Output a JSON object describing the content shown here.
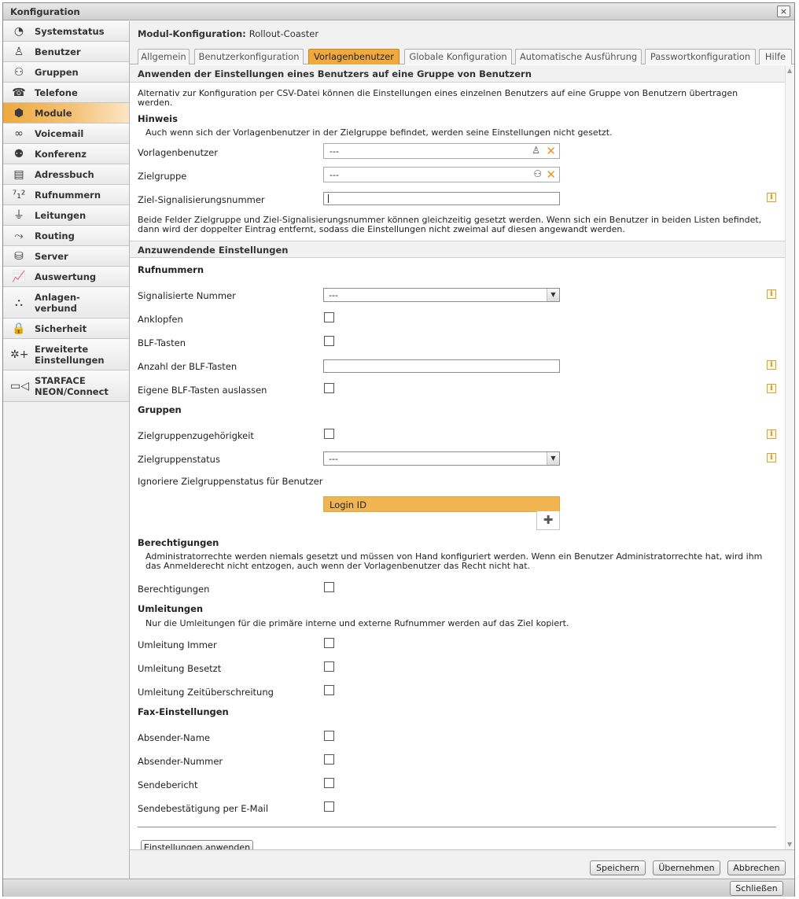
{
  "window": {
    "title": "Konfiguration",
    "close_glyph": "×"
  },
  "sidebar": {
    "items": [
      {
        "label": "Systemstatus",
        "icon": "gauge-icon",
        "glyph": "◔"
      },
      {
        "label": "Benutzer",
        "icon": "user-icon",
        "glyph": "♙"
      },
      {
        "label": "Gruppen",
        "icon": "group-icon",
        "glyph": "⚇"
      },
      {
        "label": "Telefone",
        "icon": "phone-icon",
        "glyph": "☎"
      },
      {
        "label": "Module",
        "icon": "module-icon",
        "glyph": "⬢"
      },
      {
        "label": "Voicemail",
        "icon": "voicemail-icon",
        "glyph": "∞"
      },
      {
        "label": "Konferenz",
        "icon": "conference-icon",
        "glyph": "⚉"
      },
      {
        "label": "Adressbuch",
        "icon": "addressbook-icon",
        "glyph": "▤"
      },
      {
        "label": "Rufnummern",
        "icon": "numbers-icon",
        "glyph": "⁷₁²"
      },
      {
        "label": "Leitungen",
        "icon": "lines-icon",
        "glyph": "⏚"
      },
      {
        "label": "Routing",
        "icon": "routing-icon",
        "glyph": "⤳"
      },
      {
        "label": "Server",
        "icon": "server-icon",
        "glyph": "⛁"
      },
      {
        "label": "Auswertung",
        "icon": "chart-icon",
        "glyph": "📈"
      },
      {
        "label": "Anlagen-\nverbund",
        "icon": "network-icon",
        "glyph": "⛬"
      },
      {
        "label": "Sicherheit",
        "icon": "lock-icon",
        "glyph": "🔒"
      },
      {
        "label": "Erweiterte\nEinstellungen",
        "icon": "advanced-settings-icon",
        "glyph": "✲+"
      },
      {
        "label": "STARFACE\nNEON/Connect",
        "icon": "video-icon",
        "glyph": "▭◁"
      }
    ],
    "active_index": 4
  },
  "module_header": {
    "label": "Modul-Konfiguration:",
    "name": "Rollout-Coaster"
  },
  "tabs": [
    {
      "label": "Allgemein"
    },
    {
      "label": "Benutzerkonfiguration"
    },
    {
      "label": "Vorlagenbenutzer"
    },
    {
      "label": "Globale Konfiguration"
    },
    {
      "label": "Automatische Ausführung"
    },
    {
      "label": "Passwortkonfiguration"
    },
    {
      "label": "Hilfe"
    }
  ],
  "active_tab": 2,
  "section1": {
    "title": "Anwenden der Einstellungen eines Benutzers auf eine Gruppe von Benutzern",
    "intro": "Alternativ zur Konfiguration per CSV-Datei können die Einstellungen eines einzelnen Benutzers auf eine Gruppe von Benutzern übertragen werden.",
    "hint_title": "Hinweis",
    "hint_text": "Auch wenn sich der Vorlagenbenutzer in der Zielgruppe befindet, werden seine Einstellungen nicht gesetzt.",
    "template_user_label": "Vorlagenbenutzer",
    "template_user_value": "---",
    "target_group_label": "Zielgruppe",
    "target_group_value": "---",
    "signal_number_label": "Ziel-Signalisierungsnummer",
    "note": "Beide Felder Zielgruppe und Ziel-Signalisierungsnummer können gleichzeitig gesetzt werden. Wenn sich ein Benutzer in beiden Listen befindet, dann wird der doppelter Eintrag entfernt, sodass die Einstellungen nicht zweimal auf diesen angewandt werden."
  },
  "section2": {
    "title": "Anzuwendende Einstellungen",
    "rufnummern": {
      "title": "Rufnummern",
      "signalized_label": "Signalisierte Nummer",
      "signalized_value": "---",
      "call_waiting_label": "Anklopfen",
      "blf_label": "BLF-Tasten",
      "blf_count_label": "Anzahl der BLF-Tasten",
      "skip_blf_label": "Eigene BLF-Tasten auslassen"
    },
    "gruppen": {
      "title": "Gruppen",
      "membership_label": "Zielgruppenzugehörigkeit",
      "status_label": "Zielgruppenstatus",
      "status_value": "---",
      "ignore_label": "Ignoriere Zielgruppenstatus für Benutzer",
      "ignore_item": "Login ID"
    },
    "berechtigungen": {
      "title": "Berechtigungen",
      "text": "Administratorrechte werden niemals gesetzt und müssen von Hand konfiguriert werden. Wenn ein Benutzer Administratorrechte hat, wird ihm das Anmelderecht nicht entzogen, auch wenn der Vorlagenbenutzer das Recht nicht hat.",
      "label": "Berechtigungen"
    },
    "umleitungen": {
      "title": "Umleitungen",
      "text": "Nur die Umleitungen für die primäre interne und externe Rufnummer werden auf das Ziel kopiert.",
      "always_label": "Umleitung Immer",
      "busy_label": "Umleitung Besetzt",
      "timeout_label": "Umleitung Zeitüberschreitung"
    },
    "fax": {
      "title": "Fax-Einstellungen",
      "sender_name_label": "Absender-Name",
      "sender_number_label": "Absender-Nummer",
      "report_label": "Sendebericht",
      "email_confirm_label": "Sendebestätigung per E-Mail"
    },
    "apply_button": "Einstellungen anwenden"
  },
  "footer": {
    "save": "Speichern",
    "apply": "Übernehmen",
    "cancel": "Abbrechen"
  },
  "statusbar": {
    "close": "Schließen"
  }
}
